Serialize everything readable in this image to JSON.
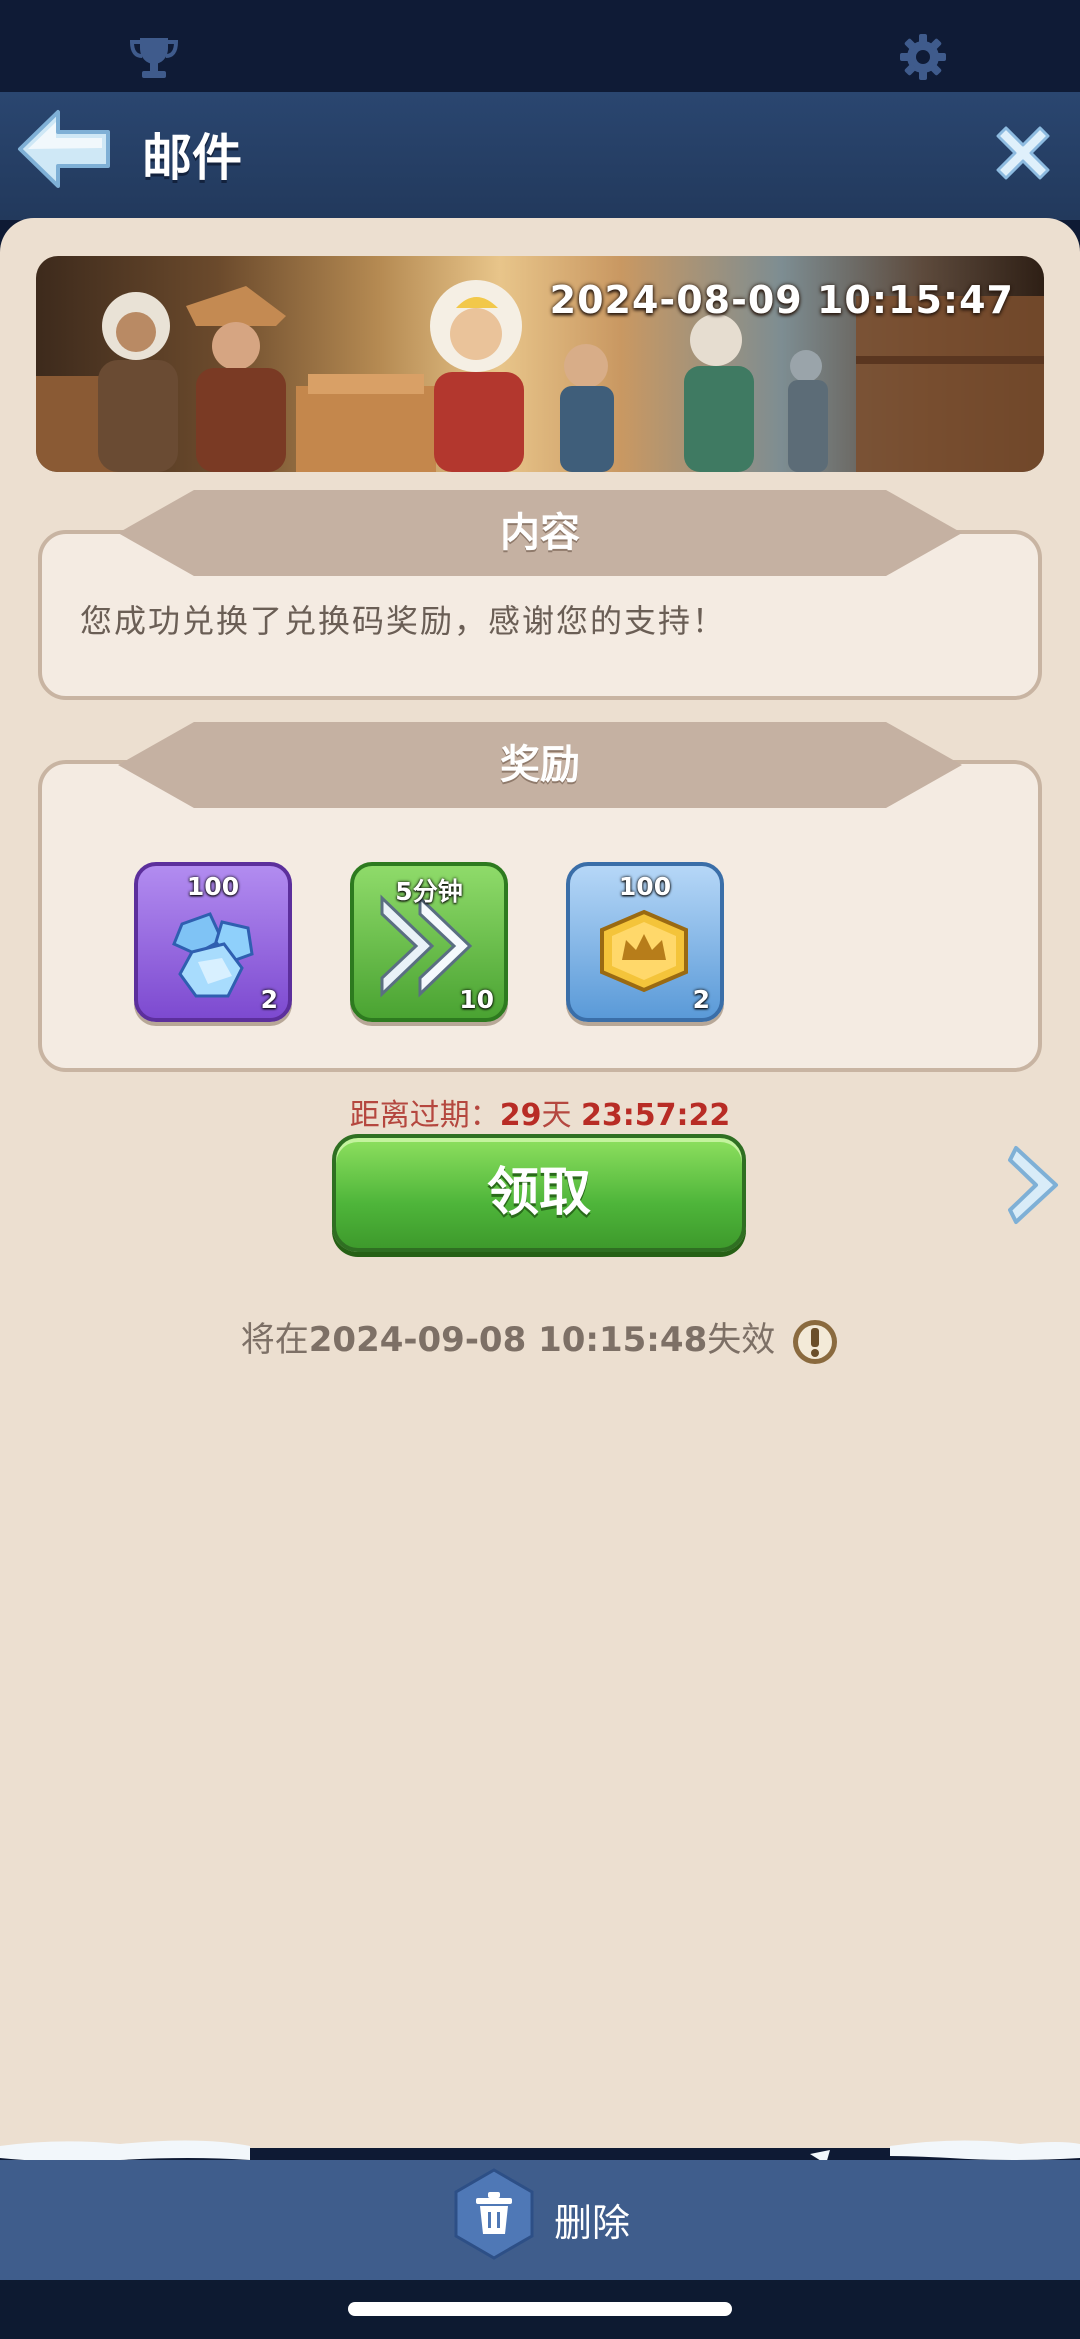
{
  "header": {
    "title": "邮件"
  },
  "top_icons": [
    "trophy-icon",
    "gear-icon"
  ],
  "banner": {
    "timestamp": "2024-08-09 10:15:47"
  },
  "content_section": {
    "heading": "内容",
    "text": "您成功兑换了兑换码奖励，感谢您的支持！"
  },
  "reward_section": {
    "heading": "奖励",
    "items": [
      {
        "icon": "gem-icon",
        "top_label": "100",
        "count": "2"
      },
      {
        "icon": "speedup-icon",
        "top_label": "5分钟",
        "count": "10"
      },
      {
        "icon": "crown-badge-icon",
        "top_label": "100",
        "count": "2"
      }
    ]
  },
  "expiry": {
    "prefix": "距离过期：",
    "days": "29",
    "days_unit": "天",
    "time": "23:57:22"
  },
  "claim_button": {
    "label": "领取"
  },
  "validity": {
    "prefix": "将在",
    "datetime": "2024-09-08 10:15:48",
    "suffix": "失效"
  },
  "bottom_bar": {
    "delete_label": "删除"
  },
  "colors": {
    "panel_bg": "#ecdfd0",
    "header_bg": "#22395c",
    "claim_green": "#4eb53a",
    "expiry_red": "#b82c25",
    "bottom_bar": "#3f5d8c"
  }
}
